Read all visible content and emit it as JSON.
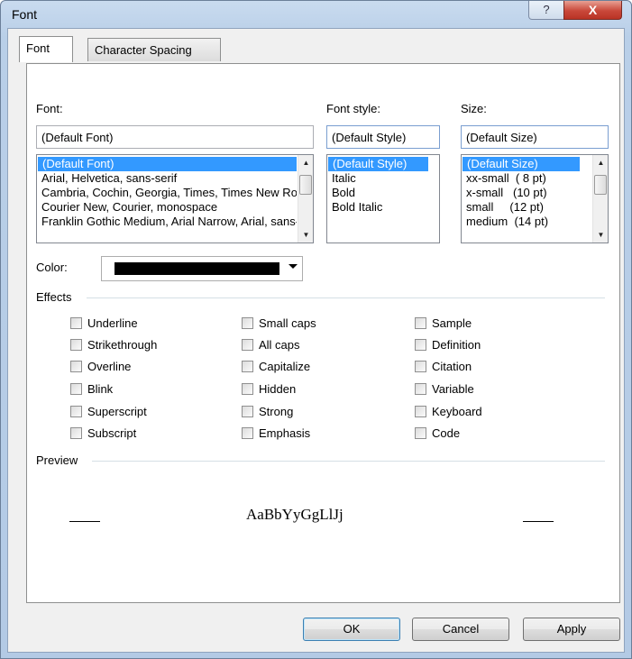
{
  "window": {
    "title": "Font",
    "help_glyph": "?",
    "close_glyph": "X"
  },
  "tabs": [
    {
      "label": "Font",
      "active": true
    },
    {
      "label": "Character Spacing",
      "active": false
    }
  ],
  "font": {
    "label": "Font:",
    "value": "(Default Font)",
    "options": [
      "(Default Font)",
      "Arial, Helvetica, sans-serif",
      "Cambria, Cochin, Georgia, Times, Times New Roman, serif",
      "Courier New, Courier, monospace",
      "Franklin Gothic Medium,  Arial Narrow, Arial, sans-serif"
    ],
    "selected_index": 0
  },
  "font_style": {
    "label": "Font style:",
    "value": "(Default Style)",
    "options": [
      "(Default Style)",
      "Italic",
      "Bold",
      "Bold Italic"
    ],
    "selected_index": 0
  },
  "size": {
    "label": "Size:",
    "value": "(Default Size)",
    "options": [
      "(Default Size)",
      "xx-small  ( 8 pt)",
      "x-small   (10 pt)",
      "small     (12 pt)",
      "medium  (14 pt)"
    ],
    "selected_index": 0
  },
  "color": {
    "label": "Color:",
    "value_hex": "#000000"
  },
  "effects": {
    "label": "Effects",
    "columns": [
      [
        "Underline",
        "Strikethrough",
        "Overline",
        "Blink",
        "Superscript",
        "Subscript"
      ],
      [
        "Small caps",
        "All caps",
        "Capitalize",
        "Hidden",
        "Strong",
        "Emphasis"
      ],
      [
        "Sample",
        "Definition",
        "Citation",
        "Variable",
        "Keyboard",
        "Code"
      ]
    ]
  },
  "preview": {
    "label": "Preview",
    "sample_text": "AaBbYyGgLlJj"
  },
  "buttons": {
    "ok": "OK",
    "cancel": "Cancel",
    "apply": "Apply"
  },
  "colors": {
    "selection": "#3399ff",
    "frame": "#b9cfe8",
    "focus_border": "#7a9ed0"
  }
}
